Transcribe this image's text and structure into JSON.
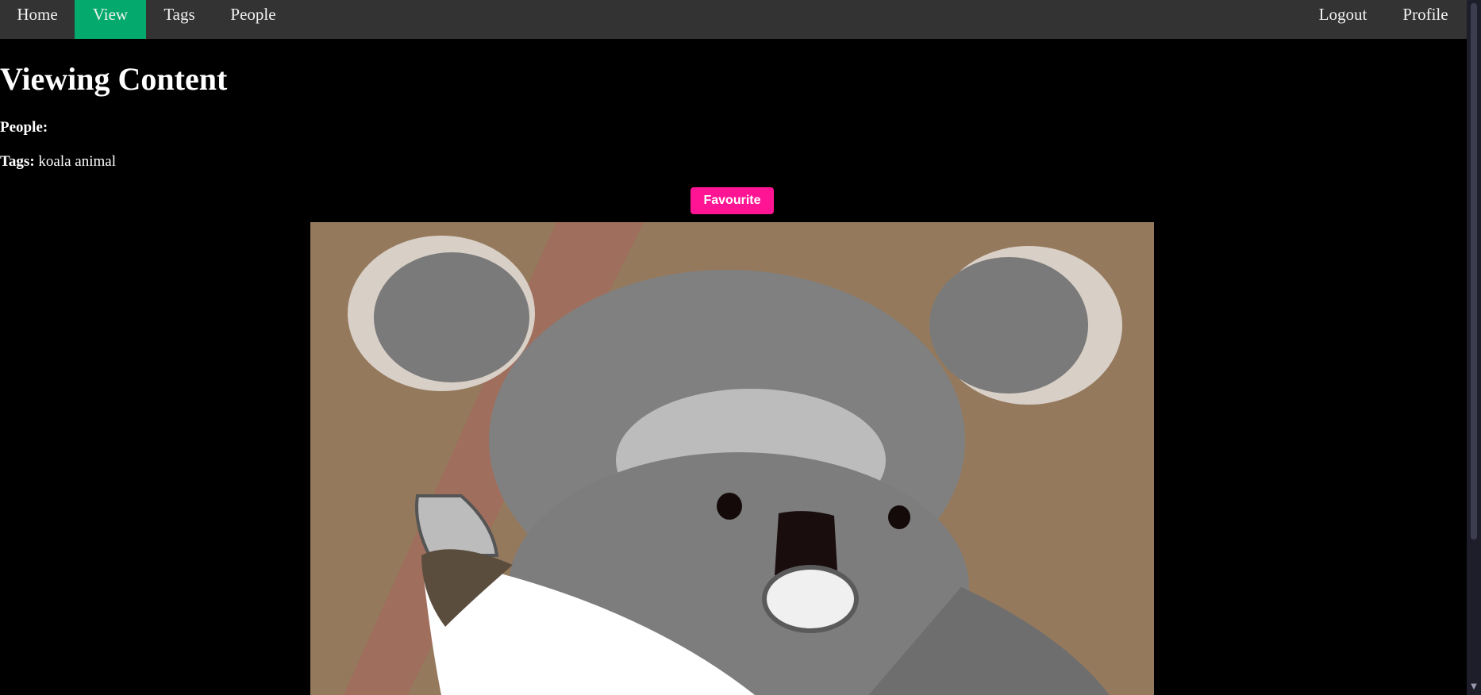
{
  "nav": {
    "home": "Home",
    "view": "View",
    "tags": "Tags",
    "people": "People",
    "logout": "Logout",
    "profile": "Profile",
    "active": "View",
    "active_color": "#04AA6D",
    "bar_color": "#333333"
  },
  "page": {
    "title": "Viewing Content",
    "people_label": "People:",
    "people_value": "",
    "tags_label": "Tags:",
    "tags_value": "koala animal"
  },
  "actions": {
    "favourite_label": "Favourite",
    "favourite_color": "#ff1493"
  },
  "image": {
    "subject": "koala drawing",
    "icon": "image-koala"
  },
  "scrollbar": {
    "down_icon": "chevron-down-icon"
  }
}
